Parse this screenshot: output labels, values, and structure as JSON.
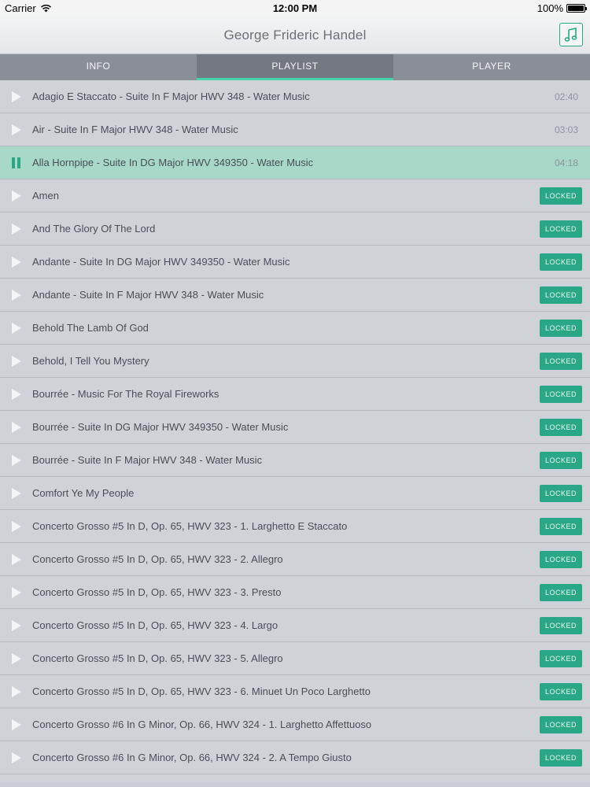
{
  "status": {
    "carrier": "Carrier",
    "time": "12:00 PM",
    "battery": "100%"
  },
  "header": {
    "title": "George Frideric Handel",
    "music_icon": "music-note-icon"
  },
  "tabs": [
    {
      "label": "INFO",
      "active": false
    },
    {
      "label": "PLAYLIST",
      "active": true
    },
    {
      "label": "PLAYER",
      "active": false
    }
  ],
  "playlist": [
    {
      "title": "Adagio E Staccato - Suite In F Major HWV 348 - Water Music",
      "duration": "02:40"
    },
    {
      "title": "Air - Suite In F Major HWV 348 - Water Music",
      "duration": "03:03"
    },
    {
      "title": "Alla Hornpipe - Suite In DG Major HWV 349350 - Water Music",
      "duration": "04:18",
      "playing": true
    },
    {
      "title": "Amen",
      "locked": "LOCKED"
    },
    {
      "title": "And The Glory Of The Lord",
      "locked": "LOCKED"
    },
    {
      "title": "Andante - Suite In DG Major HWV 349350 - Water Music",
      "locked": "LOCKED"
    },
    {
      "title": "Andante - Suite In F Major HWV 348 - Water Music",
      "locked": "LOCKED"
    },
    {
      "title": "Behold The Lamb Of God",
      "locked": "LOCKED"
    },
    {
      "title": "Behold, I Tell You Mystery",
      "locked": "LOCKED"
    },
    {
      "title": "Bourrée - Music For The Royal Fireworks",
      "locked": "LOCKED"
    },
    {
      "title": "Bourrée - Suite In DG Major HWV 349350 - Water Music",
      "locked": "LOCKED"
    },
    {
      "title": "Bourrée - Suite In F Major HWV 348 - Water Music",
      "locked": "LOCKED"
    },
    {
      "title": "Comfort Ye My People",
      "locked": "LOCKED"
    },
    {
      "title": "Concerto Grosso #5 In D, Op. 65, HWV 323 - 1. Larghetto E Staccato",
      "locked": "LOCKED"
    },
    {
      "title": "Concerto Grosso #5 In D, Op. 65, HWV 323 - 2. Allegro",
      "locked": "LOCKED"
    },
    {
      "title": "Concerto Grosso #5 In D, Op. 65, HWV 323 - 3. Presto",
      "locked": "LOCKED"
    },
    {
      "title": "Concerto Grosso #5 In D, Op. 65, HWV 323 - 4. Largo",
      "locked": "LOCKED"
    },
    {
      "title": "Concerto Grosso #5 In D, Op. 65, HWV 323 - 5. Allegro",
      "locked": "LOCKED"
    },
    {
      "title": "Concerto Grosso #5 In D, Op. 65, HWV 323 - 6. Minuet Un Poco Larghetto",
      "locked": "LOCKED"
    },
    {
      "title": "Concerto Grosso #6 In G Minor, Op. 66, HWV 324 - 1. Larghetto Affettuoso",
      "locked": "LOCKED"
    },
    {
      "title": "Concerto Grosso #6 In G Minor, Op. 66, HWV 324 - 2. A Tempo Giusto",
      "locked": "LOCKED"
    }
  ],
  "colors": {
    "accent": "#2aa886",
    "tab_indicator": "#45d2a8",
    "playing_row": "#a8d8c7"
  }
}
